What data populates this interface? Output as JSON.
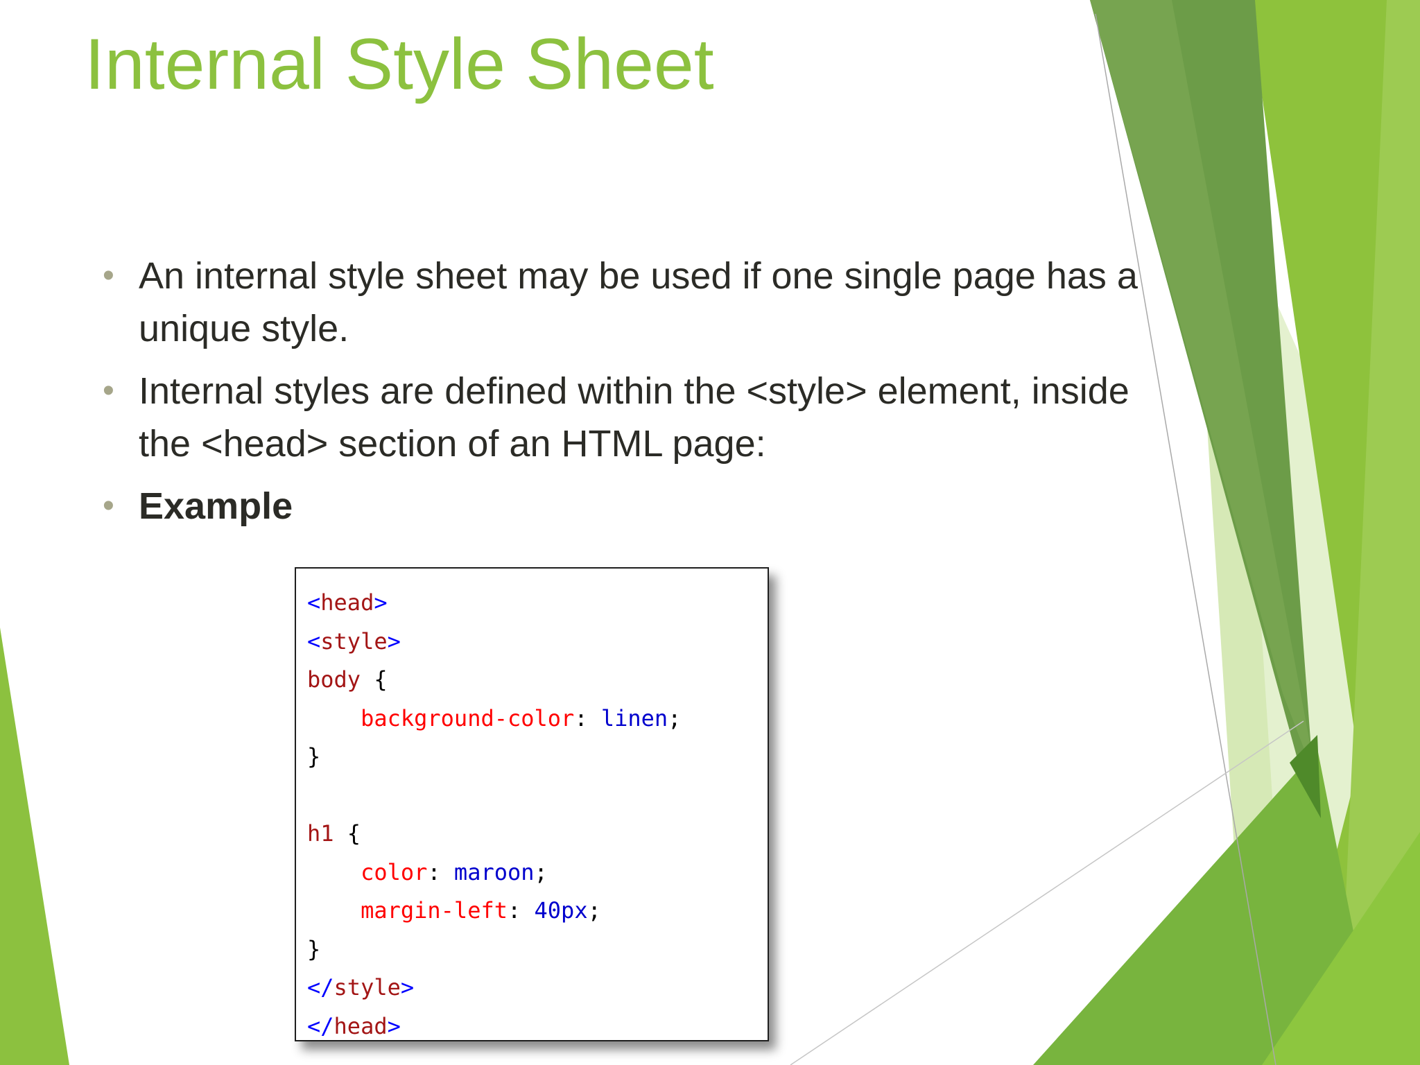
{
  "slide": {
    "title": "Internal Style Sheet",
    "bullets": [
      {
        "text": "An internal style sheet may be used if one single page has a unique style.",
        "bold": false
      },
      {
        "text": "Internal styles are defined within the <style> element, inside the <head> section of an HTML page:",
        "bold": false
      },
      {
        "text": "Example",
        "bold": true
      }
    ],
    "bullet_symbol": "•"
  },
  "code_example": {
    "lines": [
      {
        "open": "<",
        "name": "head",
        "close": ">"
      },
      {
        "open": "<",
        "name": "style",
        "close": ">"
      },
      {
        "selector": "body",
        "brace": " {"
      },
      {
        "indent": "    ",
        "property": "background-color",
        "colon": ": ",
        "value": "linen",
        "semi": ";"
      },
      {
        "brace_close": "}"
      },
      {
        "blank": ""
      },
      {
        "selector": "h1",
        "brace": " {"
      },
      {
        "indent": "    ",
        "property": "color",
        "colon": ": ",
        "value": "maroon",
        "semi": ";"
      },
      {
        "indent": "    ",
        "property": "margin-left",
        "colon": ": ",
        "value": "40px",
        "semi": ";"
      },
      {
        "brace_close": "}"
      },
      {
        "open": "</",
        "name": "style",
        "close": ">"
      },
      {
        "open": "</",
        "name": "head",
        "close": ">"
      }
    ]
  },
  "theme": {
    "accent": "#8cc13f",
    "text": "#2b2b26",
    "bullet_color": "#a6a68a",
    "decor_dark_green": "#5e9a3a",
    "decor_light_green": "#d4e8b4"
  }
}
